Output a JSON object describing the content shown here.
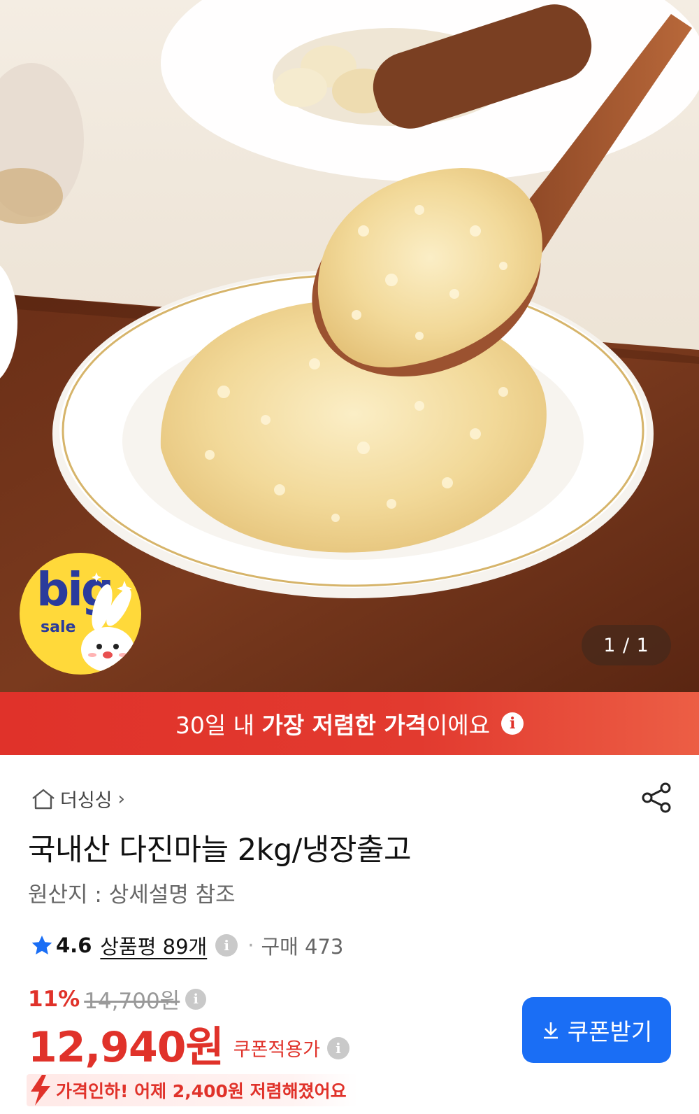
{
  "hero": {
    "counter": "1 / 1",
    "badge": {
      "big": "big",
      "sale": "sale"
    }
  },
  "banner": {
    "prefix": "30일 내 ",
    "bold": "가장 저렴한 가격",
    "suffix": "이에요"
  },
  "product": {
    "store_name": "더싱싱",
    "title": "국내산 다진마늘 2kg/냉장출고",
    "origin": "원산지 : 상세설명 참조",
    "rating": "4.6",
    "reviews_label": "상품평 89개",
    "purchase_label": "구매 473",
    "discount_rate": "11%",
    "original_price": "14,700원",
    "coupon_price": "12,940원",
    "coupon_price_label": "쿠폰적용가",
    "coupon_button": "쿠폰받기",
    "price_drop_note": "가격인하! 어제 2,400원 저렴해졌어요"
  },
  "colors": {
    "accent_red": "#e0322a",
    "button_blue": "#1a6ef5",
    "badge_yellow": "#ffd93a",
    "star_blue": "#1a6ef5"
  }
}
